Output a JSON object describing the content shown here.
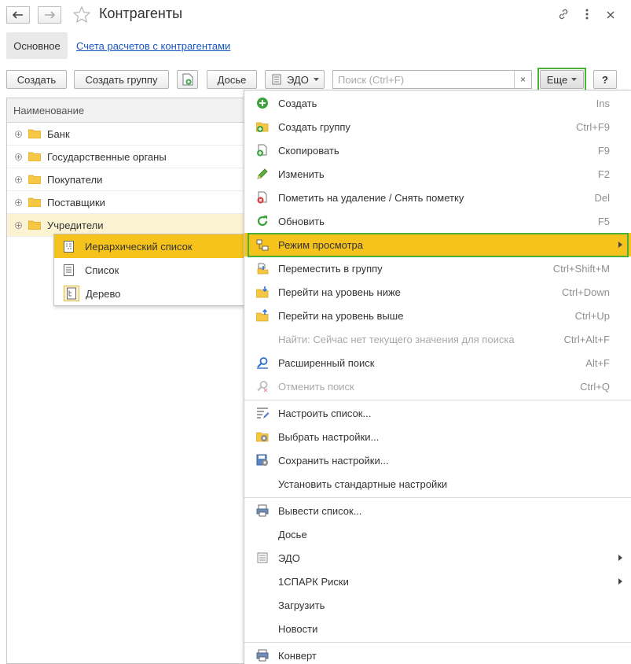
{
  "window": {
    "title": "Контрагенты"
  },
  "tabs": {
    "main": "Основное",
    "accounts_link": "Счета расчетов с контрагентами"
  },
  "toolbar": {
    "create": "Создать",
    "create_group": "Создать группу",
    "dossier": "Досье",
    "edo": "ЭДО",
    "search_placeholder": "Поиск (Ctrl+F)",
    "search_clear": "×",
    "more": "Еще",
    "help": "?"
  },
  "list": {
    "column_header": "Наименование",
    "rows": [
      {
        "label": "Банк"
      },
      {
        "label": "Государственные органы"
      },
      {
        "label": "Покупатели"
      },
      {
        "label": "Поставщики"
      },
      {
        "label": "Учредители"
      }
    ]
  },
  "view_mode_submenu": {
    "items": [
      {
        "label": "Иерархический список",
        "icon": "hierarchical-list-icon"
      },
      {
        "label": "Список",
        "icon": "list-icon"
      },
      {
        "label": "Дерево",
        "icon": "tree-icon"
      }
    ]
  },
  "more_menu": {
    "items": [
      {
        "label": "Создать",
        "shortcut": "Ins",
        "icon": "add-green-circle-icon"
      },
      {
        "label": "Создать группу",
        "shortcut": "Ctrl+F9",
        "icon": "add-folder-icon"
      },
      {
        "label": "Скопировать",
        "shortcut": "F9",
        "icon": "copy-icon"
      },
      {
        "label": "Изменить",
        "shortcut": "F2",
        "icon": "pencil-icon"
      },
      {
        "label": "Пометить на удаление / Снять пометку",
        "shortcut": "Del",
        "icon": "mark-delete-icon"
      },
      {
        "label": "Обновить",
        "shortcut": "F5",
        "icon": "refresh-icon"
      },
      {
        "label": "Режим просмотра",
        "shortcut": "",
        "icon": "view-mode-icon"
      },
      {
        "label": "Переместить в группу",
        "shortcut": "Ctrl+Shift+M",
        "icon": "move-to-group-icon"
      },
      {
        "label": "Перейти на уровень ниже",
        "shortcut": "Ctrl+Down",
        "icon": "level-down-icon"
      },
      {
        "label": "Перейти на уровень выше",
        "shortcut": "Ctrl+Up",
        "icon": "level-up-icon"
      },
      {
        "label": "Найти: Сейчас нет текущего значения для поиска",
        "shortcut": "Ctrl+Alt+F",
        "icon": ""
      },
      {
        "label": "Расширенный поиск",
        "shortcut": "Alt+F",
        "icon": "advanced-search-icon"
      },
      {
        "label": "Отменить поиск",
        "shortcut": "Ctrl+Q",
        "icon": "cancel-search-icon"
      },
      {
        "label": "Настроить список...",
        "shortcut": "",
        "icon": "configure-list-icon"
      },
      {
        "label": "Выбрать настройки...",
        "shortcut": "",
        "icon": "choose-settings-icon"
      },
      {
        "label": "Сохранить настройки...",
        "shortcut": "",
        "icon": "save-settings-icon"
      },
      {
        "label": "Установить стандартные настройки",
        "shortcut": "",
        "icon": ""
      },
      {
        "label": "Вывести список...",
        "shortcut": "",
        "icon": "print-list-icon"
      },
      {
        "label": "Досье",
        "shortcut": "",
        "icon": ""
      },
      {
        "label": "ЭДО",
        "shortcut": "",
        "icon": "edo-icon"
      },
      {
        "label": "1СПАРК Риски",
        "shortcut": "",
        "icon": ""
      },
      {
        "label": "Загрузить",
        "shortcut": "",
        "icon": ""
      },
      {
        "label": "Новости",
        "shortcut": "",
        "icon": ""
      },
      {
        "label": "Конверт",
        "shortcut": "",
        "icon": "printer-icon"
      }
    ]
  },
  "colors": {
    "highlight": "#f6c21c",
    "highlight_border": "#4caf3a",
    "selected_row": "#fcf3d2",
    "link": "#1a56c4",
    "folder": "#f5c744"
  }
}
